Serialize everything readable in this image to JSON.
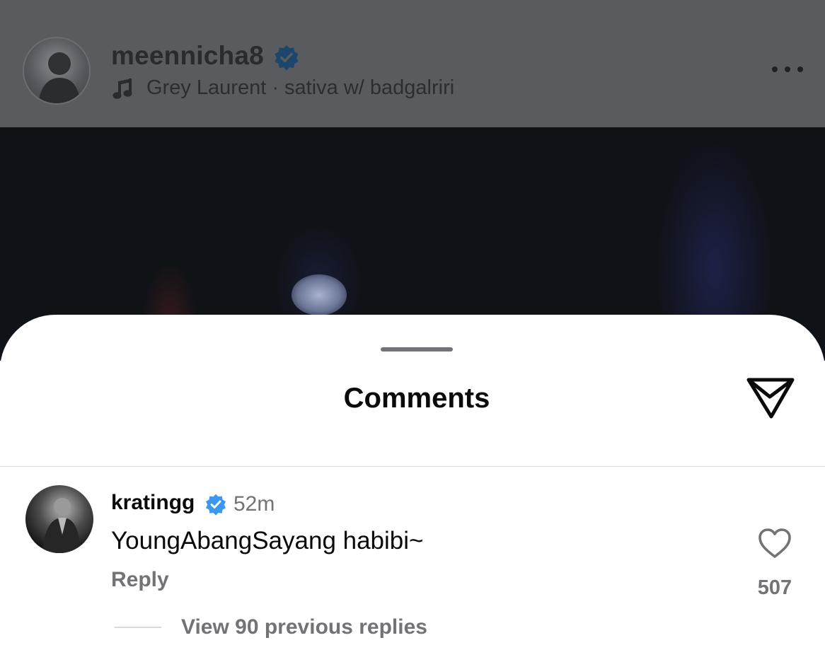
{
  "post": {
    "username": "meennicha8",
    "verified_icon": "verified-badge-icon",
    "audio": "Grey Laurent · sativa w/ badgalriri",
    "more_icon": "more-icon"
  },
  "comments_sheet": {
    "title": "Comments",
    "share_icon": "send-icon"
  },
  "comments": [
    {
      "username": "kratingg",
      "verified": true,
      "time": "52m",
      "text": "YoungAbangSayang habibi~",
      "reply_label": "Reply",
      "like_count": "507",
      "view_replies": "View 90 previous replies"
    }
  ],
  "colors": {
    "verified_blue": "#3b97f0",
    "secondary_text": "#737377",
    "dim_overlay": "#595b5f"
  }
}
